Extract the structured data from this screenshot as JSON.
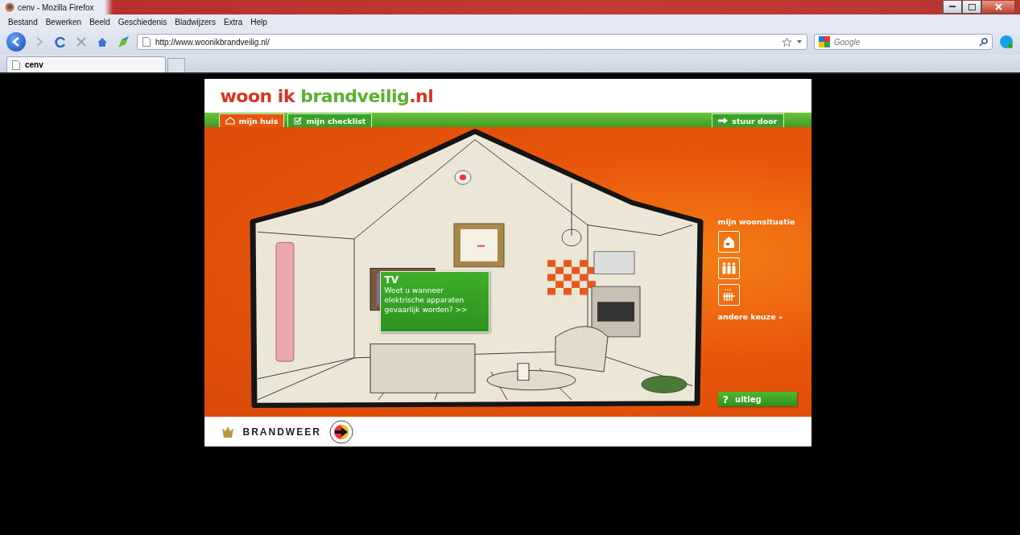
{
  "window": {
    "title": "cenv - Mozilla Firefox"
  },
  "menu": [
    "Bestand",
    "Bewerken",
    "Beeld",
    "Geschiedenis",
    "Bladwijzers",
    "Extra",
    "Help"
  ],
  "address": {
    "value": "http://www.woonikbrandveilig.nl/"
  },
  "search": {
    "placeholder": "Google"
  },
  "tabs": [
    {
      "label": "cenv",
      "selected": true
    }
  ],
  "site": {
    "logo": [
      {
        "text": "woon ik ",
        "color": "#d9341e"
      },
      {
        "text": "brandveilig",
        "color": "#5cb02e"
      },
      {
        "text": ".nl",
        "color": "#d9341e"
      }
    ],
    "nav": [
      {
        "label": "mijn huis",
        "kind": "house",
        "selected": true
      },
      {
        "label": "mijn checklist",
        "kind": "check",
        "selected": false
      }
    ],
    "send": {
      "label": "stuur door"
    },
    "popup": {
      "title": "TV",
      "text": "Weet u wanneer elektrische apparaten gevaarlijk worden? >>"
    },
    "side": {
      "heading": "mijn woonsituatie",
      "options": [
        {
          "kind": "house"
        },
        {
          "kind": "people"
        },
        {
          "kind": "radiator"
        }
      ],
      "link": "andere keuze",
      "link_mark": "»"
    },
    "help": {
      "mark": "?",
      "label": "uitleg"
    },
    "footer": {
      "brand": "BRANDWEER"
    }
  }
}
